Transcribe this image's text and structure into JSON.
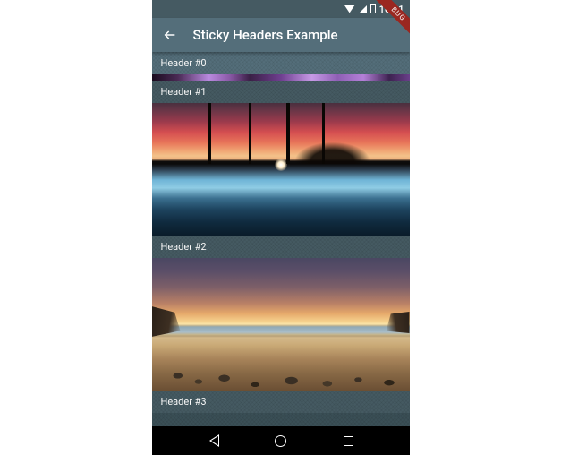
{
  "status": {
    "time": "16:21"
  },
  "ribbon": "BUG",
  "appbar": {
    "title": "Sticky Headers Example"
  },
  "headers": {
    "h0": "Header #0",
    "h1": "Header #1",
    "h2": "Header #2",
    "h3": "Header #3"
  }
}
